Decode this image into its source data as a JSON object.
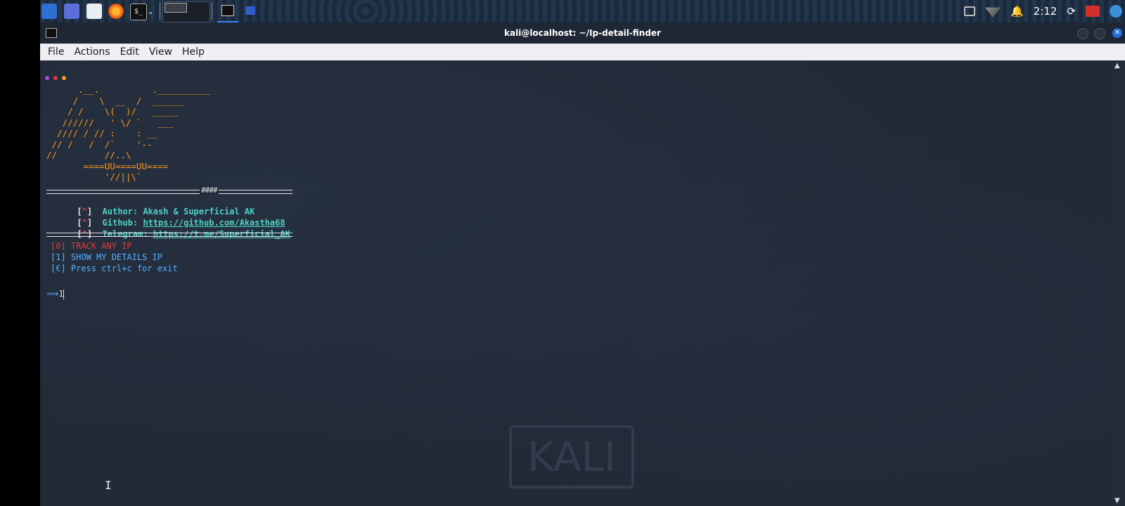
{
  "taskbar": {
    "apps": [
      "kali-menu-icon",
      "workspace-icon",
      "file-manager-icon",
      "firefox-icon",
      "terminal-icon"
    ],
    "terminal_glyph": "$_",
    "clock": "2:12"
  },
  "window": {
    "title": "kali@localhost: ~/Ip-detail-finder",
    "menu": [
      "File",
      "Actions",
      "Edit",
      "View",
      "Help"
    ]
  },
  "terminal": {
    "banner_art": "      .__.          .__________\n     /    \\  __  /  ______\n    / /    \\(  )/   _____\n   //////   ' \\/ `   ___\n  //// / // :    : __\n // /   /  /`    '--\n//         //..\\\n       ====UU====UU====\n           '//||\\`",
    "rule_mark": "####",
    "author_label": "Author: Akash & Superficial AK",
    "github_label": "Github: ",
    "github_url": "https://github.com/Akastha68",
    "telegram_label": "Telegram: ",
    "telegram_url": "https://t.me/Superficial_AK",
    "bracket_open": "[",
    "caret": "^",
    "bracket_close": "]",
    "options": [
      {
        "text": "[0] TRACK ANY IP",
        "color": "#e03c3c"
      },
      {
        "text": "[1] SHOW MY DETAILS IP",
        "color": "#5ab0ff"
      },
      {
        "text": "[€] Press ctrl+c for exit",
        "color": "#5ab0ff"
      }
    ],
    "prompt_arrow": "⟹",
    "prompt_input": "1"
  },
  "watermark": "KALI",
  "colors": {
    "accent": "#ff9a1f",
    "cyan": "#4fd1c5",
    "red": "#e03c3c",
    "blue": "#5ab0ff",
    "background": "#222a37"
  }
}
